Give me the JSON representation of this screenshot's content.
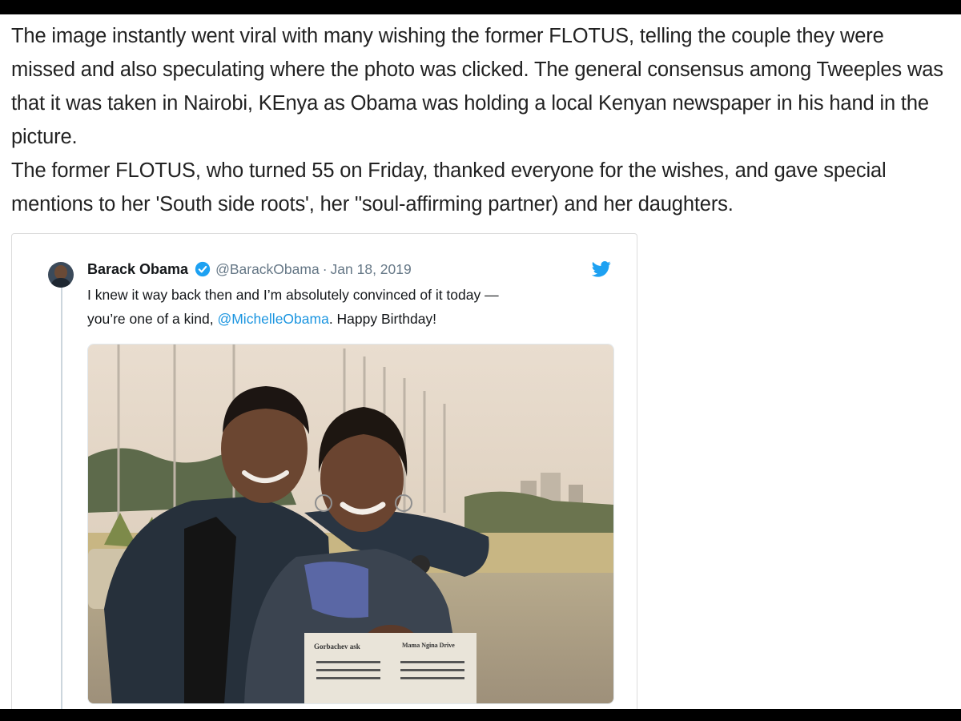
{
  "article": {
    "paragraph1": "The image instantly went viral with many wishing the former FLOTUS, telling the couple they were missed and also speculating where the photo was clicked. The general consensus among Tweeples was that it was taken in Nairobi, KEnya as Obama was holding a local Kenyan newspaper in his hand in the picture.",
    "paragraph2": "The former FLOTUS, who turned 55 on Friday, thanked everyone for the wishes, and gave special mentions to her 'South side roots', her \"soul-affirming partner) and her daughters."
  },
  "tweet": {
    "author_name": "Barack Obama",
    "handle": "@BarackObama",
    "separator": "·",
    "date": "Jan 18, 2019",
    "text_line1": "I knew it way back then and I’m absolutely convinced of it today —",
    "text_line2_prefix": "you’re one of a kind, ",
    "mention": "@MichelleObama",
    "text_line2_suffix": ". Happy Birthday!",
    "photo": {
      "newspaper_text_left": "Gorbachev ask",
      "newspaper_text_right": "Mama Ngina Drive"
    }
  },
  "colors": {
    "link_blue": "#1b95e0",
    "verified_blue": "#1da1f2",
    "muted_gray": "#657786"
  },
  "icons": [
    "verified-badge-icon",
    "twitter-bird-icon"
  ]
}
